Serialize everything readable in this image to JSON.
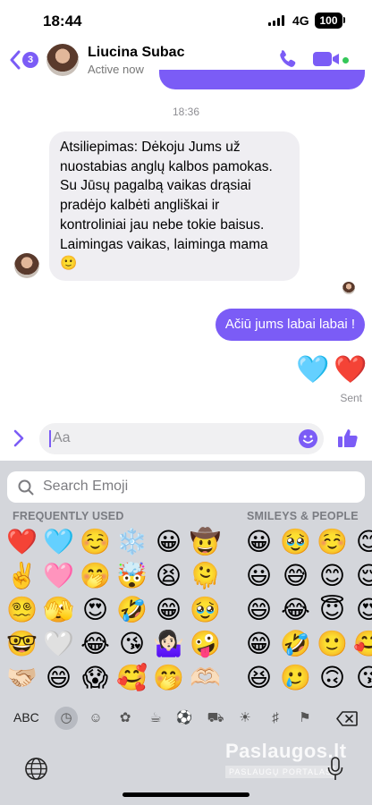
{
  "status_bar": {
    "time": "18:44",
    "network": "4G",
    "battery": "100"
  },
  "header": {
    "unread_count": "3",
    "contact_name": "Liucina Subac",
    "status": "Active now"
  },
  "messages": {
    "timestamp": "18:36",
    "received_text": "Atsiliepimas:  Dėkoju Jums už nuostabias anglų kalbos pamokas. Su Jūsų pagalbą vaikas drąsiai pradėjo kalbėti angliškai ir kontroliniai jau nebe tokie baisus. Laimingas vaikas, laiminga mama\n🙂",
    "sent_text": "Ačiū jums labai labai !",
    "sent_reactions": [
      "🩵",
      "❤️"
    ],
    "delivery_status": "Sent"
  },
  "composer": {
    "placeholder": "Aa"
  },
  "emoji_keyboard": {
    "search_placeholder": "Search Emoji",
    "frequently_used_label": "FREQUENTLY USED",
    "smileys_label": "SMILEYS & PEOPLE",
    "frequently_used": [
      "❤️",
      "🩵",
      "☺️",
      "❄️",
      "😀",
      "🤠",
      "✌️",
      "🩷",
      "🤭",
      "🤯",
      "😫",
      "🫠",
      "😵‍💫",
      "🫣",
      "😍",
      "🤣",
      "😁",
      "🥹",
      "🤓",
      "🤍",
      "😂",
      "😘",
      "🤷🏻‍♀️",
      "🤪",
      "🫱🏻‍🫲🏼",
      "😄",
      "😱",
      "🥰",
      "🤭",
      "🫶🏻"
    ],
    "smileys_people": [
      "😀",
      "🥹",
      "☺️",
      "😊",
      "😃",
      "😅",
      "😊",
      "😌",
      "😄",
      "😂",
      "😇",
      "😍",
      "😁",
      "🤣",
      "🙂",
      "🥰",
      "😆",
      "🥲",
      "🙃",
      "😘"
    ],
    "abc_label": "ABC",
    "categories": [
      "recent",
      "smileys",
      "animals",
      "food",
      "activity",
      "travel",
      "objects",
      "symbols",
      "flags"
    ]
  },
  "watermark": {
    "title": "Paslaugos.lt",
    "subtitle": "PASLAUGŲ PORTALAS"
  }
}
